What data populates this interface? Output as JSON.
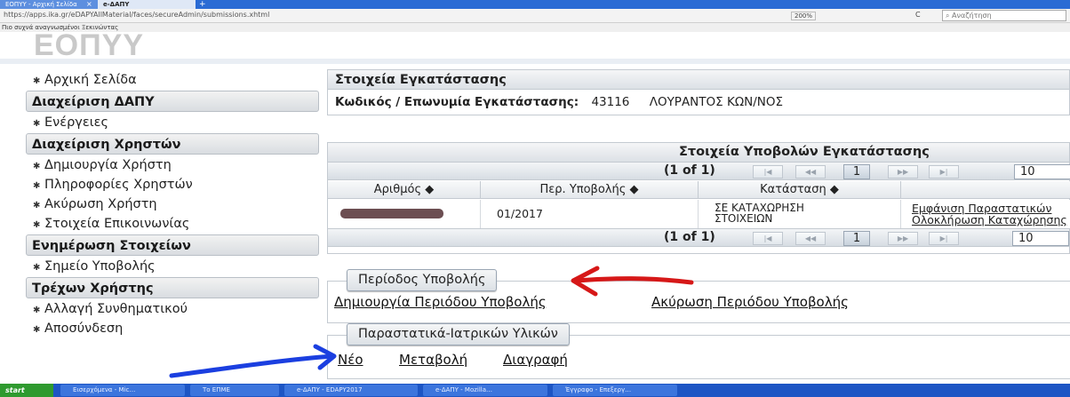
{
  "browser": {
    "tabs": [
      "ΕΟΠΥΥ - Αρχική Σελίδα",
      "e-ΔΑΠΥ"
    ],
    "url": "https://apps.ika.gr/eDAPYAllMaterial/faces/secureAdmin/submissions.xhtml",
    "zoom": "200%",
    "search_placeholder": "Αναζήτηση",
    "bookmarks": "Πιο συχνά αναγνωσμένοι   Ξεκινώντας"
  },
  "logo": "ΕΟΠΥΥ",
  "sidebar": {
    "items": [
      {
        "kind": "link",
        "label": "Αρχική Σελίδα"
      },
      {
        "kind": "head",
        "label": "Διαχείριση ΔΑΠΥ"
      },
      {
        "kind": "link",
        "label": "Ενέργειες"
      },
      {
        "kind": "head",
        "label": "Διαχείριση Χρηστών"
      },
      {
        "kind": "link",
        "label": "Δημιουργία Χρήστη"
      },
      {
        "kind": "link",
        "label": "Πληροφορίες Χρηστών"
      },
      {
        "kind": "link",
        "label": "Ακύρωση Χρήστη"
      },
      {
        "kind": "link",
        "label": "Στοιχεία Επικοινωνίας"
      },
      {
        "kind": "head",
        "label": "Ενημέρωση Στοιχείων"
      },
      {
        "kind": "link",
        "label": "Σημείο Υποβολής"
      },
      {
        "kind": "head",
        "label": "Τρέχων Χρήστης"
      },
      {
        "kind": "link",
        "label": "Αλλαγή Συνθηματικού"
      },
      {
        "kind": "link",
        "label": "Αποσύνδεση"
      }
    ]
  },
  "installation": {
    "title": "Στοιχεία Εγκατάστασης",
    "code_label": "Κωδικός / Επωνυμία Εγκατάστασης:",
    "code": "43116",
    "name": "ΛΟΥΡΑΝΤΟΣ ΚΩΝ/ΝΟΣ"
  },
  "submissions": {
    "title": "Στοιχεία Υποβολών Εγκατάστασης",
    "pager": {
      "count": "(1 of 1)",
      "current": "1",
      "page_size": "10"
    },
    "columns": [
      "Αριθμός ◆",
      "Περ. Υποβολής ◆",
      "Κατάσταση ◆"
    ],
    "rows": [
      {
        "period": "01/2017",
        "status_line1": "ΣΕ ΚΑΤΑΧΩΡΗΣΗ",
        "status_line2": "ΣΤΟΙΧΕΙΩΝ",
        "action1": "Εμφάνιση Παραστατικών",
        "action2": "Ολοκλήρωση Καταχώρησης"
      }
    ]
  },
  "period_section": {
    "legend": "Περίοδος Υποβολής",
    "create_link": "Δημιουργία Περιόδου Υποβολής",
    "cancel_link": "Ακύρωση Περιόδου Υποβολής"
  },
  "materials_section": {
    "legend": "Παραστατικά-Ιατρικών Υλικών",
    "new_link": "Νέο",
    "modify_link": "Μεταβολή",
    "delete_link": "Διαγραφή"
  },
  "taskbar": {
    "start": "start",
    "tasks": [
      "Εισερχόμενα - Mic…",
      "Το ΕΠΜΕ",
      "e-ΔΑΠΥ - EDAPY2017",
      "e-ΔΑΠΥ - Mozilla…",
      "Έγγραφο - Επεξεργ…"
    ]
  },
  "annotations": {
    "red_arrow": "#d61818",
    "blue_arrow": "#1b3fe0"
  }
}
